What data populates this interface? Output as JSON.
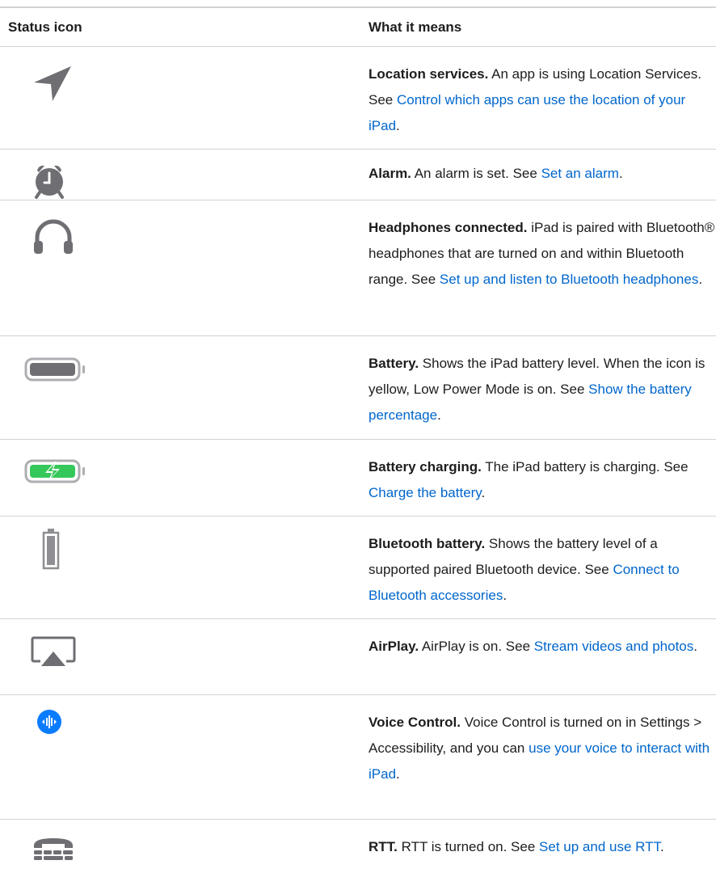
{
  "table": {
    "headers": {
      "icon": "Status icon",
      "meaning": "What it means"
    },
    "rows": [
      {
        "icon": "location-arrow-icon",
        "title": "Location services.",
        "text": " An app is using Location Services. See ",
        "link": "Control which apps can use the location of your iPad",
        "after": "."
      },
      {
        "icon": "alarm-clock-icon",
        "title": "Alarm.",
        "text": " An alarm is set. See ",
        "link": "Set an alarm",
        "after": "."
      },
      {
        "icon": "headphones-icon",
        "title": "Headphones connected.",
        "text": " iPad is paired with Bluetooth® headphones that are turned on and within Bluetooth range. See ",
        "link": "Set up and listen to Bluetooth headphones",
        "after": "."
      },
      {
        "icon": "battery-icon",
        "title": "Battery.",
        "text": " Shows the iPad battery level. When the icon is yellow, Low Power Mode is on. See ",
        "link": "Show the battery percentage",
        "after": "."
      },
      {
        "icon": "battery-charging-icon",
        "title": "Battery charging.",
        "text": " The iPad battery is charging. See ",
        "link": "Charge the battery",
        "after": "."
      },
      {
        "icon": "bluetooth-battery-icon",
        "title": "Bluetooth battery.",
        "text": " Shows the battery level of a supported paired Bluetooth device. See ",
        "link": "Connect to Bluetooth accessories",
        "after": "."
      },
      {
        "icon": "airplay-icon",
        "title": "AirPlay.",
        "text": " AirPlay is on. See ",
        "link": "Stream videos and photos",
        "after": "."
      },
      {
        "icon": "voice-control-icon",
        "title": "Voice Control.",
        "text": " Voice Control is turned on in Settings > Accessibility, and you can ",
        "link": "use your voice to interact with iPad",
        "after": "."
      },
      {
        "icon": "rtt-phone-icon",
        "title": "RTT.",
        "text": " RTT is turned on. See ",
        "link": "Set up and use RTT",
        "after": "."
      }
    ]
  },
  "colors": {
    "link": "#0066cc",
    "icon_gray": "#6e6e73",
    "battery_green": "#34c759",
    "voice_blue": "#0a7cff",
    "divider": "#d2d2d7"
  }
}
